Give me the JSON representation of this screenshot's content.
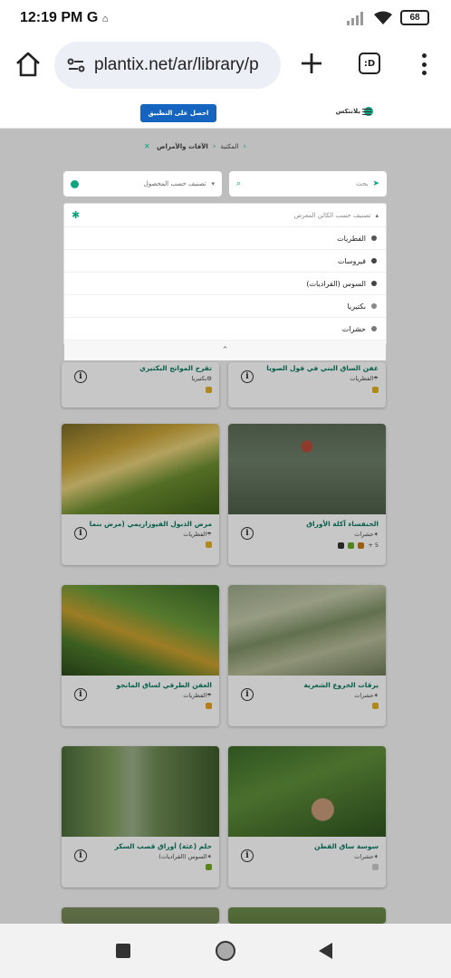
{
  "status_bar": {
    "time": "12:19 PM",
    "carrier_icon": "G",
    "battery": "68"
  },
  "browser": {
    "url": "plantix.net/ar/library/p",
    "tab_count": ":D"
  },
  "header": {
    "get_app_button": "احصل على التطبيق",
    "brand_name": "بلانتكس"
  },
  "breadcrumb": {
    "library": "المكتبة",
    "current": "الآفات والأمراض",
    "close": "×"
  },
  "search": {
    "placeholder": "بحث"
  },
  "crop_filter": {
    "placeholder": "تصنيف حسب المحصول"
  },
  "organism_filter": {
    "placeholder": "تصنيف حسب الكائن المعرض",
    "options": [
      {
        "label": "الفطريات",
        "icon": "fungus-icon"
      },
      {
        "label": "فيروسات",
        "icon": "virus-icon"
      },
      {
        "label": "السوس (القراديات)",
        "icon": "mite-icon"
      },
      {
        "label": "بكتيريا",
        "icon": "bacteria-icon"
      },
      {
        "label": "حشرات",
        "icon": "insect-icon"
      }
    ]
  },
  "cards": [
    {
      "title": "تقرح المواتج البكتيري",
      "category": "بكتيريا",
      "crops": ""
    },
    {
      "title": "عفن الساق البني في فول الصويا",
      "category": "الفطريات",
      "crops": ""
    },
    {
      "title": "مرض الذبول الفيوزاريمي (مرض بنما)",
      "category": "الفطريات",
      "crops": ""
    },
    {
      "title": "الخنفساء آكلة الأوراق",
      "category": "حشرات",
      "crops": "5 +"
    },
    {
      "title": "العفن الطرفي لساق المانجو",
      "category": "الفطريات",
      "crops": ""
    },
    {
      "title": "يرقات الخروع الشعرية",
      "category": "حشرات",
      "crops": ""
    },
    {
      "title": "حلم (عثة) أوراق قصب السكر",
      "category": "السوس (القراديات)",
      "crops": ""
    },
    {
      "title": "سوسة ساق القطن",
      "category": "حشرات",
      "crops": ""
    }
  ],
  "colors": {
    "accent": "#0fa37f",
    "app_button": "#1565c0"
  }
}
